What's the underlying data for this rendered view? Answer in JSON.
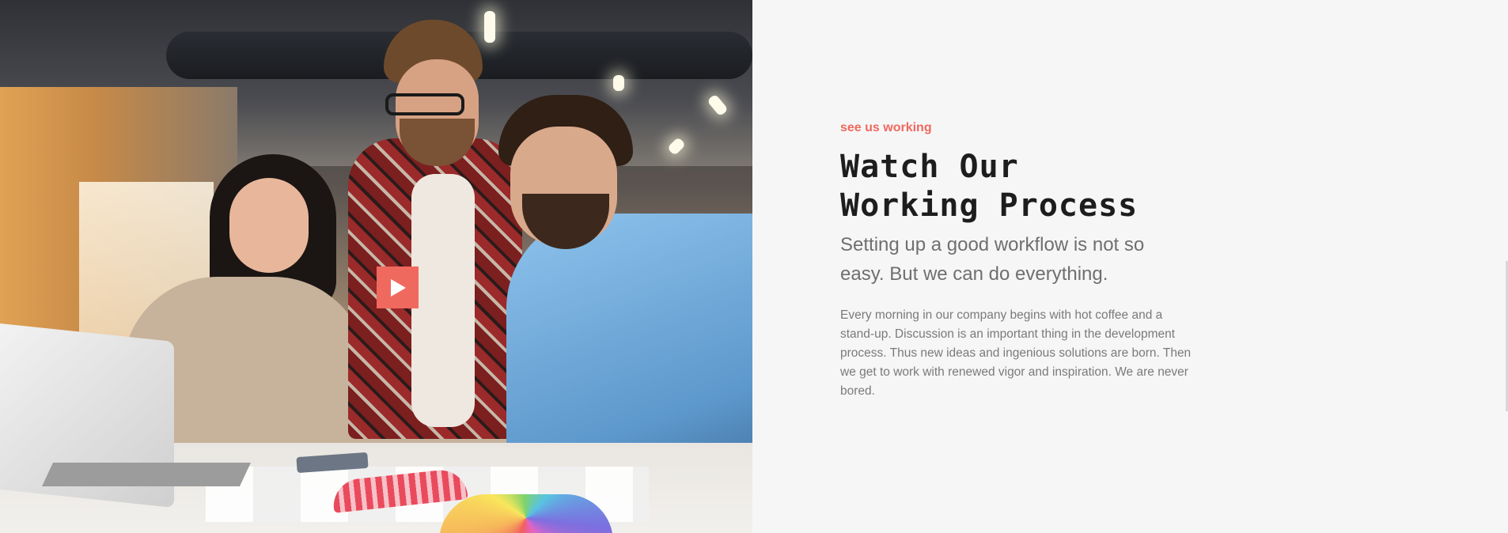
{
  "video_section": {
    "play_icon": "play-icon",
    "accent_color": "#f0695f"
  },
  "content": {
    "eyebrow": "see us working",
    "headline": "Watch Our Working Process",
    "subheadline": "Setting up a good workflow is not so easy. But we can do everything.",
    "body": "Every morning in our company begins with hot coffee and a stand-up. Discussion is an important thing in the development process. Thus new ideas and ingenious solutions are born. Then we get to work with renewed vigor and inspiration. We are never bored."
  },
  "colors": {
    "background": "#f6f6f6",
    "heading": "#1d1d1d",
    "subheading": "#6f6f6f",
    "body": "#7a7a7a",
    "accent": "#f0695f"
  }
}
